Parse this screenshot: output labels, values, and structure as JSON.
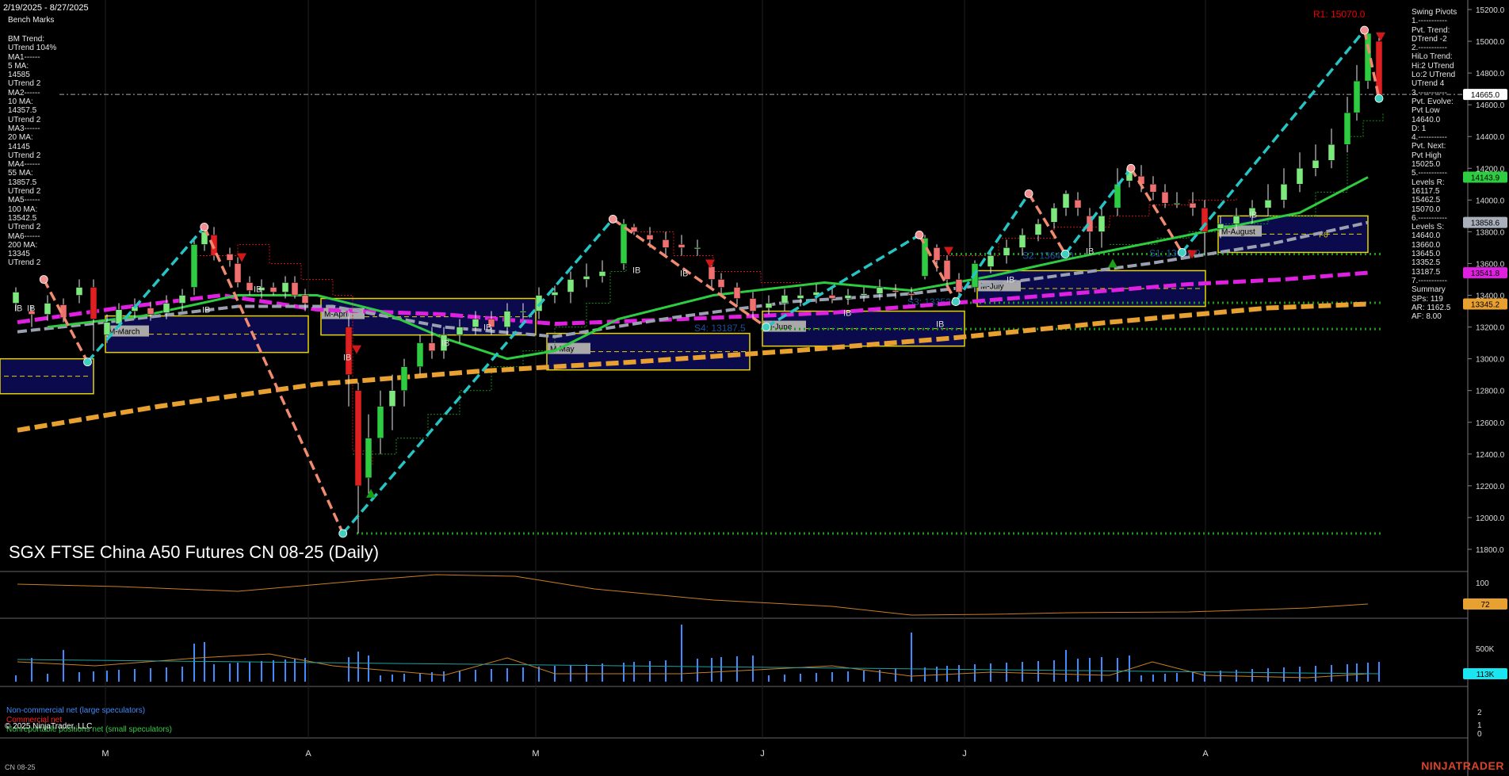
{
  "header": {
    "date_range": "2/19/2025 - 8/27/2025",
    "bench_title": "Bench Marks"
  },
  "left_panel": [
    "BM Trend:",
    "UTrend 104%",
    "MA1------",
    "5 MA:",
    "14585",
    "UTrend 2",
    "MA2------",
    "10 MA:",
    "14357.5",
    "UTrend 2",
    "MA3------",
    "20 MA:",
    "14145",
    "UTrend 2",
    "MA4------",
    "55 MA:",
    "13857.5",
    "UTrend 2",
    "MA5------",
    "100 MA:",
    "13542.5",
    "UTrend 2",
    "MA6------",
    "200 MA:",
    "13345",
    "UTrend 2"
  ],
  "right_panel": [
    "Swing Pivots",
    "1.-----------",
    "Pvt. Trend:",
    "DTrend -2",
    "2.-----------",
    "HiLo Trend:",
    "Hi:2 UTrend",
    "Lo:2 UTrend",
    "UTrend 4",
    "3.-----------",
    "Pvt. Evolve:",
    "Pvt Low",
    "14640.0",
    "D: 1",
    "4.-----------",
    "Pvt. Next:",
    "Pvt High",
    "15025.0",
    "5.-----------",
    "Levels R:",
    "16117.5",
    "15462.5",
    "15070.0",
    "6.-----------",
    "Levels S:",
    "14640.0",
    "13660.0",
    "13645.0",
    "13352.5",
    "13187.5",
    "7.-----------",
    "Summary",
    "SPs: 119",
    "AR: 1162.5",
    "AF: 8.00"
  ],
  "r1_label": "R1: 15070.0",
  "title": "SGX FTSE China A50 Futures CN 08-25 (Daily)",
  "copyright": "© 2025 NinjaTrader, LLC",
  "brand": "NINJATRADER",
  "symbol": "CN 08-25",
  "cot_legend": {
    "noncommercial": "Non-commercial net (large speculators)",
    "commercial": "Commercial net",
    "small": "Nonreportable positions net (small speculators)"
  },
  "price_axis": {
    "ticks": [
      "15200.0",
      "15000.0",
      "14800.0",
      "14600.0",
      "14400.0",
      "14200.0",
      "14000.0",
      "13800.0",
      "13600.0",
      "13400.0",
      "13200.0",
      "13000.0",
      "12800.0",
      "12600.0",
      "12400.0",
      "12200.0",
      "12000.0",
      "11800.0"
    ],
    "current_tags": [
      {
        "label": "14665.0",
        "color": "#ffffff",
        "value": 14665
      },
      {
        "label": "14143.9",
        "color": "#2ecc40",
        "value": 14143.9
      },
      {
        "label": "13858.6",
        "color": "#aab0bb",
        "value": 13858.6
      },
      {
        "label": "13541.8",
        "color": "#e020e0",
        "value": 13541.8
      },
      {
        "label": "13345.2",
        "color": "#e8a030",
        "value": 13345.2
      }
    ]
  },
  "indicator_axis": {
    "ticks": [
      "100"
    ],
    "tag": {
      "label": "72",
      "color": "#e8a030"
    }
  },
  "volume_axis": {
    "ticks": [
      "500K"
    ],
    "tag": {
      "label": "113K",
      "color": "#19e6f0"
    }
  },
  "cot_axis": {
    "ticks": [
      "2",
      "1",
      "0"
    ]
  },
  "x_axis_months": [
    "M",
    "A",
    "M",
    "J",
    "J",
    "A"
  ],
  "box_labels": [
    "M-March",
    "M-April",
    "M-May",
    "M-June",
    "M-July",
    "M-August"
  ],
  "level_labels": [
    "S4: 13187.5",
    "S3: 13352.5",
    "S2: 13645.0",
    "S1: 13660.0",
    "F0"
  ],
  "inside_bar_label": "IB",
  "chart_data": {
    "type": "candlestick",
    "title": "SGX FTSE China A50 Futures CN 08-25 (Daily)",
    "ylim": [
      11750,
      15250
    ],
    "pivots": [
      {
        "date": "2025-02-25",
        "value": 13500,
        "kind": "high"
      },
      {
        "date": "2025-03-03",
        "value": 12980,
        "kind": "low"
      },
      {
        "date": "2025-03-19",
        "value": 13830,
        "kind": "high"
      },
      {
        "date": "2025-04-07",
        "value": 11900,
        "kind": "low"
      },
      {
        "date": "2025-05-14",
        "value": 13880,
        "kind": "high"
      },
      {
        "date": "2025-06-04",
        "value": 13200,
        "kind": "low"
      },
      {
        "date": "2025-06-25",
        "value": 13780,
        "kind": "high"
      },
      {
        "date": "2025-06-30",
        "value": 13360,
        "kind": "low"
      },
      {
        "date": "2025-07-10",
        "value": 14040,
        "kind": "high"
      },
      {
        "date": "2025-07-15",
        "value": 13660,
        "kind": "low"
      },
      {
        "date": "2025-07-24",
        "value": 14200,
        "kind": "high"
      },
      {
        "date": "2025-07-31",
        "value": 13670,
        "kind": "low"
      },
      {
        "date": "2025-08-25",
        "value": 15070,
        "kind": "high"
      },
      {
        "date": "2025-08-27",
        "value": 14640,
        "kind": "low"
      }
    ],
    "moving_averages": [
      {
        "name": "20 MA",
        "value": 14145,
        "color": "#2ecc40"
      },
      {
        "name": "55 MA",
        "value": 13857.5,
        "color": "#9aa0b0"
      },
      {
        "name": "100 MA",
        "value": 13542.5,
        "color": "#e020e0"
      },
      {
        "name": "200 MA",
        "value": 13345,
        "color": "#e8a030"
      }
    ],
    "volume_last": 113000,
    "indicator_last": 72
  }
}
